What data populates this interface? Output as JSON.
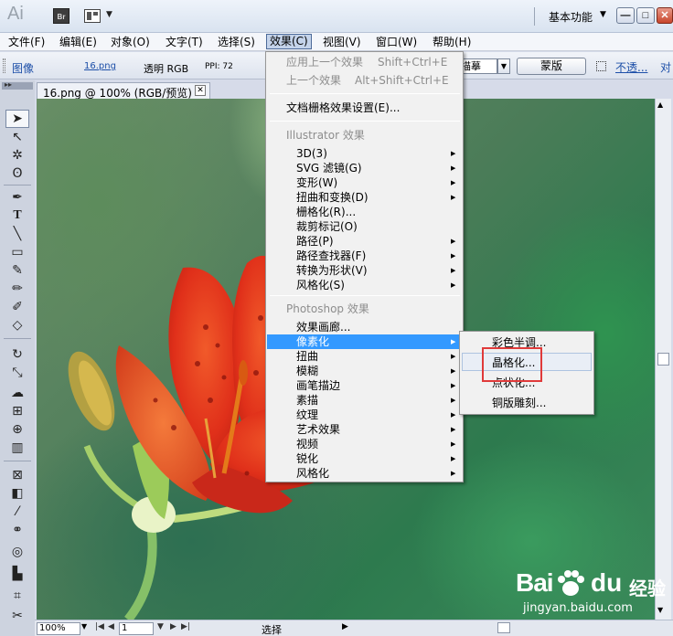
{
  "titlebar": {
    "app_logo": "Ai",
    "bridge_label": "Br",
    "workspace": "基本功能",
    "workspace_dropdown": "▼",
    "arrange_dropdown": "▼",
    "minimize": "—",
    "maximize": "□",
    "close": "✕"
  },
  "menubar": {
    "items": [
      "文件(F)",
      "编辑(E)",
      "对象(O)",
      "文字(T)",
      "选择(S)",
      "效果(C)",
      "视图(V)",
      "窗口(W)",
      "帮助(H)"
    ],
    "active": "效果(C)"
  },
  "controlbar": {
    "image_label": "图像",
    "file_name": "16.png",
    "color_mode": "透明 RGB",
    "ppi": "PPI: 72",
    "trace_value": "描摹",
    "mask_button": "蒙版",
    "opacity_link": "不透...",
    "align_link": "对"
  },
  "document": {
    "tab_title": "16.png @ 100% (RGB/预览)",
    "tab_close": "✕"
  },
  "statusbar": {
    "zoom": "100%",
    "page": "1",
    "status": "选择"
  },
  "effects_menu": {
    "apply_last": {
      "label": "应用上一个效果",
      "shortcut": "Shift+Ctrl+E"
    },
    "last_effect": {
      "label": "上一个效果",
      "shortcut": "Alt+Shift+Ctrl+E"
    },
    "raster_settings": "文档栅格效果设置(E)...",
    "illustrator_header": "Illustrator 效果",
    "illustrator_items": [
      "3D(3)",
      "SVG 滤镜(G)",
      "变形(W)",
      "扭曲和变换(D)",
      "栅格化(R)...",
      "裁剪标记(O)",
      "路径(P)",
      "路径查找器(F)",
      "转换为形状(V)",
      "风格化(S)"
    ],
    "photoshop_header": "Photoshop 效果",
    "photoshop_items": [
      "效果画廊...",
      "像素化",
      "扭曲",
      "模糊",
      "画笔描边",
      "素描",
      "纹理",
      "艺术效果",
      "视频",
      "锐化",
      "风格化"
    ],
    "highlighted": "像素化"
  },
  "pixelate_menu": {
    "items": [
      "彩色半调...",
      "晶格化...",
      "点状化...",
      "铜版雕刻..."
    ],
    "hovered": "晶格化..."
  },
  "watermark": {
    "brand_left": "Bai",
    "brand_right": "du",
    "product": "经验",
    "url": "jingyan.baidu.com"
  },
  "colors": {
    "menu_highlight": "#3399ff",
    "annotation_red": "#e03a3a",
    "link_blue": "#1d4fa8"
  }
}
